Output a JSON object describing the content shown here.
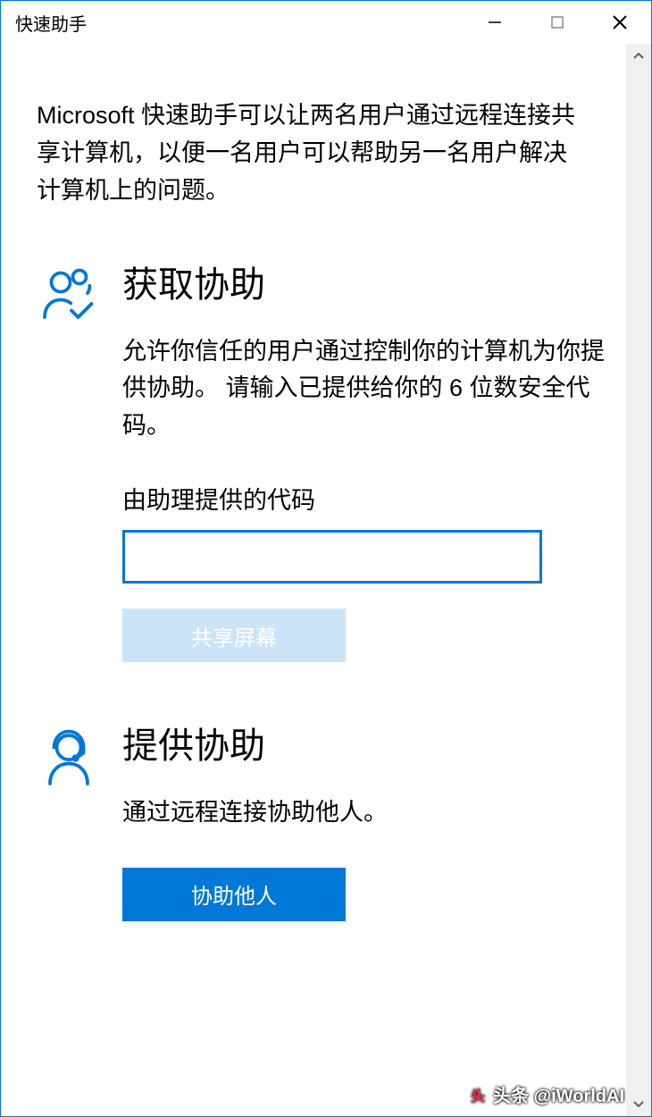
{
  "window": {
    "title": "快速助手"
  },
  "intro": "Microsoft 快速助手可以让两名用户通过远程连接共享计算机，以便一名用户可以帮助另一名用户解决计算机上的问题。",
  "get_help": {
    "title": "获取协助",
    "desc": "允许你信任的用户通过控制你的计算机为你提供协助。 请输入已提供给你的 6 位数安全代码。",
    "input_label": "由助理提供的代码",
    "input_value": "",
    "share_button": "共享屏幕"
  },
  "give_help": {
    "title": "提供协助",
    "desc": "通过远程连接协助他人。",
    "assist_button": "协助他人"
  },
  "watermark": "头条 @iWorldAI"
}
